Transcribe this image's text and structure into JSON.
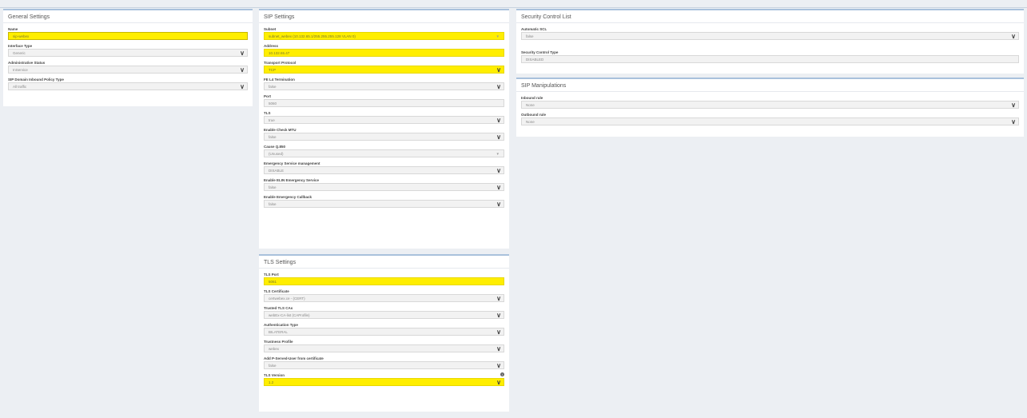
{
  "general": {
    "title": "General Settings",
    "fields": [
      {
        "label": "Name",
        "value": "sip-webex",
        "highlight": "box"
      },
      {
        "label": "Interface Type",
        "value": "Generic",
        "chevron": true
      },
      {
        "label": "Administrative Status",
        "value": "InService",
        "chevron": true
      },
      {
        "label": "SIP Domain Inbound Policy Type",
        "value": "All traffic",
        "chevron": true
      }
    ]
  },
  "sip": {
    "title": "SIP Settings",
    "fields": [
      {
        "label": "Subnet",
        "value": "subnet_webex (10.132.65.1/255.255.255.128 VLAN 0)",
        "highlight": "fill",
        "caret": true
      },
      {
        "label": "Address",
        "value": "10.132.65.47",
        "highlight": "fill"
      },
      {
        "label": "Transport Protocol",
        "value": "TCP",
        "highlight": "fill",
        "chevron": true
      },
      {
        "label": "FE L4 Termination",
        "value": "false",
        "chevron": true
      },
      {
        "label": "Port",
        "value": "5060"
      },
      {
        "label": "TLS",
        "value": "true",
        "chevron": true
      },
      {
        "label": "Enable Check MTU",
        "value": "false",
        "chevron": true
      },
      {
        "label": "Cause Q.850",
        "value": "(Unused)",
        "caret": true
      },
      {
        "label": "Emergency Service management",
        "value": "DISABLE",
        "chevron": true
      },
      {
        "label": "Enable ELIN Emergency Service",
        "value": "false",
        "chevron": true
      },
      {
        "label": "Enable Emergency Callback",
        "value": "false",
        "chevron": true
      }
    ]
  },
  "tls": {
    "title": "TLS Settings",
    "fields": [
      {
        "label": "TLS Port",
        "value": "5061",
        "highlight": "fill"
      },
      {
        "label": "TLS Certificate",
        "value": "certwebex.ce - (CERT)",
        "chevron": true
      },
      {
        "label": "Trusted TLS CAs",
        "value": "webEx-CA-list (CAProfile)",
        "chevron": true
      },
      {
        "label": "Authentication Type",
        "value": "BILATERAL",
        "chevron": true
      },
      {
        "label": "Trustness Profile",
        "value": "webex",
        "chevron": true
      },
      {
        "label": "Add P-Served-User from certificate",
        "value": "false",
        "chevron": true
      },
      {
        "label": "TLS Version",
        "value": "1.2",
        "highlight": "fill",
        "chevron": true,
        "info": true
      }
    ]
  },
  "scl": {
    "title": "Security Control List",
    "fields": [
      {
        "label": "Automatic SCL",
        "value": "false",
        "chevron": true
      },
      {
        "label": "Security Control Type",
        "value": "DISABLED",
        "gap": true
      }
    ]
  },
  "manip": {
    "title": "SIP Manipulations",
    "fields": [
      {
        "label": "Inbound rule",
        "value": "None",
        "chevron": true
      },
      {
        "label": "Outbound rule",
        "value": "None",
        "chevron": true
      }
    ]
  },
  "icons": {
    "chevron": "chevron-down-icon",
    "info": "info-icon",
    "caret": "caret-down-icon"
  }
}
